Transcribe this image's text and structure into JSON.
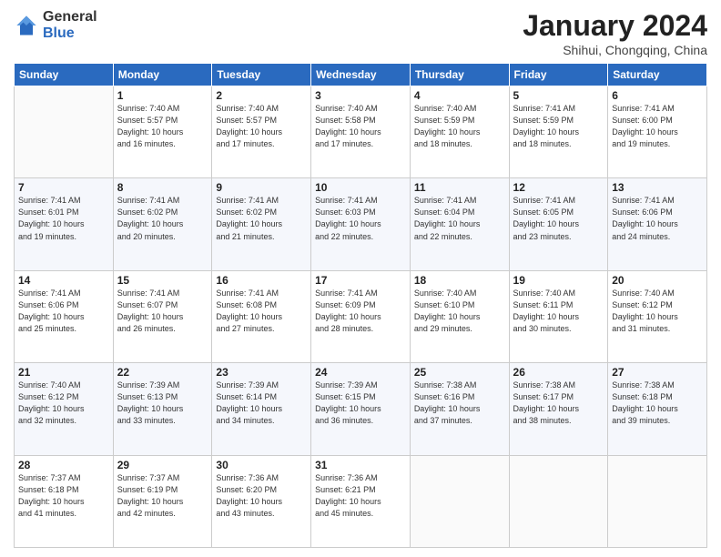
{
  "header": {
    "logo_general": "General",
    "logo_blue": "Blue",
    "title": "January 2024",
    "subtitle": "Shihui, Chongqing, China"
  },
  "days_of_week": [
    "Sunday",
    "Monday",
    "Tuesday",
    "Wednesday",
    "Thursday",
    "Friday",
    "Saturday"
  ],
  "weeks": [
    [
      {
        "day": "",
        "info": ""
      },
      {
        "day": "1",
        "info": "Sunrise: 7:40 AM\nSunset: 5:57 PM\nDaylight: 10 hours\nand 16 minutes."
      },
      {
        "day": "2",
        "info": "Sunrise: 7:40 AM\nSunset: 5:57 PM\nDaylight: 10 hours\nand 17 minutes."
      },
      {
        "day": "3",
        "info": "Sunrise: 7:40 AM\nSunset: 5:58 PM\nDaylight: 10 hours\nand 17 minutes."
      },
      {
        "day": "4",
        "info": "Sunrise: 7:40 AM\nSunset: 5:59 PM\nDaylight: 10 hours\nand 18 minutes."
      },
      {
        "day": "5",
        "info": "Sunrise: 7:41 AM\nSunset: 5:59 PM\nDaylight: 10 hours\nand 18 minutes."
      },
      {
        "day": "6",
        "info": "Sunrise: 7:41 AM\nSunset: 6:00 PM\nDaylight: 10 hours\nand 19 minutes."
      }
    ],
    [
      {
        "day": "7",
        "info": "Sunrise: 7:41 AM\nSunset: 6:01 PM\nDaylight: 10 hours\nand 19 minutes."
      },
      {
        "day": "8",
        "info": "Sunrise: 7:41 AM\nSunset: 6:02 PM\nDaylight: 10 hours\nand 20 minutes."
      },
      {
        "day": "9",
        "info": "Sunrise: 7:41 AM\nSunset: 6:02 PM\nDaylight: 10 hours\nand 21 minutes."
      },
      {
        "day": "10",
        "info": "Sunrise: 7:41 AM\nSunset: 6:03 PM\nDaylight: 10 hours\nand 22 minutes."
      },
      {
        "day": "11",
        "info": "Sunrise: 7:41 AM\nSunset: 6:04 PM\nDaylight: 10 hours\nand 22 minutes."
      },
      {
        "day": "12",
        "info": "Sunrise: 7:41 AM\nSunset: 6:05 PM\nDaylight: 10 hours\nand 23 minutes."
      },
      {
        "day": "13",
        "info": "Sunrise: 7:41 AM\nSunset: 6:06 PM\nDaylight: 10 hours\nand 24 minutes."
      }
    ],
    [
      {
        "day": "14",
        "info": "Sunrise: 7:41 AM\nSunset: 6:06 PM\nDaylight: 10 hours\nand 25 minutes."
      },
      {
        "day": "15",
        "info": "Sunrise: 7:41 AM\nSunset: 6:07 PM\nDaylight: 10 hours\nand 26 minutes."
      },
      {
        "day": "16",
        "info": "Sunrise: 7:41 AM\nSunset: 6:08 PM\nDaylight: 10 hours\nand 27 minutes."
      },
      {
        "day": "17",
        "info": "Sunrise: 7:41 AM\nSunset: 6:09 PM\nDaylight: 10 hours\nand 28 minutes."
      },
      {
        "day": "18",
        "info": "Sunrise: 7:40 AM\nSunset: 6:10 PM\nDaylight: 10 hours\nand 29 minutes."
      },
      {
        "day": "19",
        "info": "Sunrise: 7:40 AM\nSunset: 6:11 PM\nDaylight: 10 hours\nand 30 minutes."
      },
      {
        "day": "20",
        "info": "Sunrise: 7:40 AM\nSunset: 6:12 PM\nDaylight: 10 hours\nand 31 minutes."
      }
    ],
    [
      {
        "day": "21",
        "info": "Sunrise: 7:40 AM\nSunset: 6:12 PM\nDaylight: 10 hours\nand 32 minutes."
      },
      {
        "day": "22",
        "info": "Sunrise: 7:39 AM\nSunset: 6:13 PM\nDaylight: 10 hours\nand 33 minutes."
      },
      {
        "day": "23",
        "info": "Sunrise: 7:39 AM\nSunset: 6:14 PM\nDaylight: 10 hours\nand 34 minutes."
      },
      {
        "day": "24",
        "info": "Sunrise: 7:39 AM\nSunset: 6:15 PM\nDaylight: 10 hours\nand 36 minutes."
      },
      {
        "day": "25",
        "info": "Sunrise: 7:38 AM\nSunset: 6:16 PM\nDaylight: 10 hours\nand 37 minutes."
      },
      {
        "day": "26",
        "info": "Sunrise: 7:38 AM\nSunset: 6:17 PM\nDaylight: 10 hours\nand 38 minutes."
      },
      {
        "day": "27",
        "info": "Sunrise: 7:38 AM\nSunset: 6:18 PM\nDaylight: 10 hours\nand 39 minutes."
      }
    ],
    [
      {
        "day": "28",
        "info": "Sunrise: 7:37 AM\nSunset: 6:18 PM\nDaylight: 10 hours\nand 41 minutes."
      },
      {
        "day": "29",
        "info": "Sunrise: 7:37 AM\nSunset: 6:19 PM\nDaylight: 10 hours\nand 42 minutes."
      },
      {
        "day": "30",
        "info": "Sunrise: 7:36 AM\nSunset: 6:20 PM\nDaylight: 10 hours\nand 43 minutes."
      },
      {
        "day": "31",
        "info": "Sunrise: 7:36 AM\nSunset: 6:21 PM\nDaylight: 10 hours\nand 45 minutes."
      },
      {
        "day": "",
        "info": ""
      },
      {
        "day": "",
        "info": ""
      },
      {
        "day": "",
        "info": ""
      }
    ]
  ]
}
